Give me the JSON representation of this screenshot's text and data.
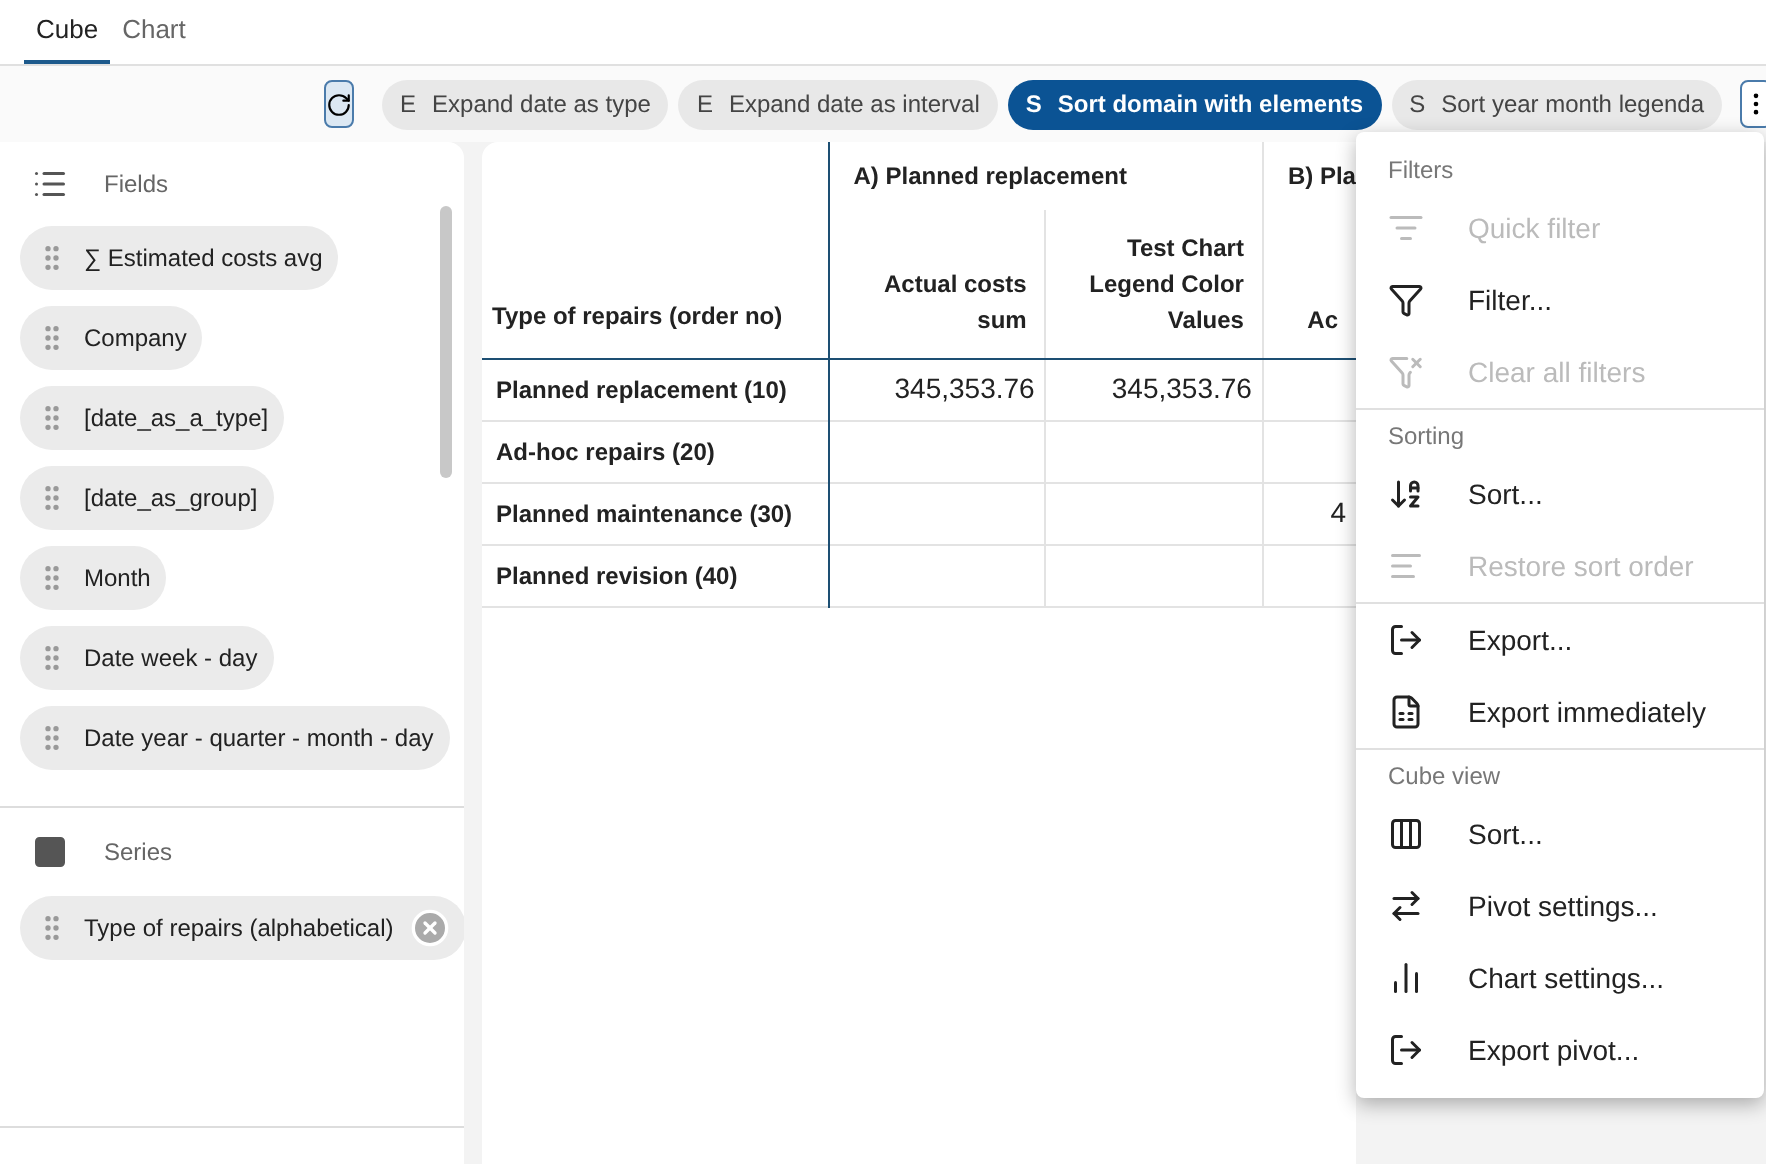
{
  "tabs": [
    {
      "label": "Cube",
      "selected": true
    },
    {
      "label": "Chart",
      "selected": false
    }
  ],
  "chips": [
    {
      "prefix": "E",
      "label": "Expand date as type",
      "selected": false
    },
    {
      "prefix": "E",
      "label": "Expand date as interval",
      "selected": false
    },
    {
      "prefix": "S",
      "label": "Sort domain with elements",
      "selected": true
    },
    {
      "prefix": "S",
      "label": "Sort year month legenda",
      "selected": false
    }
  ],
  "fields": {
    "title": "Fields",
    "items": [
      "∑ Estimated costs avg",
      "Company",
      "[date_as_a_type]",
      "[date_as_group]",
      "Month",
      "Date week - day",
      "Date year - quarter - month - day"
    ]
  },
  "series": {
    "title": "Series",
    "items": [
      "Type of repairs (alphabetical)"
    ]
  },
  "table": {
    "row_header": "Type of repairs (order no)",
    "groups": [
      {
        "label": "A) Planned replacement",
        "columns": [
          "Actual costs sum",
          "Test Chart Legend Color Values"
        ]
      },
      {
        "label": "B) Pla",
        "columns": [
          "Ac"
        ]
      }
    ],
    "rows": [
      {
        "label": "Planned replacement (10)",
        "cells": [
          "345,353.76",
          "345,353.76",
          ""
        ]
      },
      {
        "label": "Ad-hoc repairs (20)",
        "cells": [
          "",
          "",
          ""
        ]
      },
      {
        "label": "Planned maintenance (30)",
        "cells": [
          "",
          "",
          "4"
        ]
      },
      {
        "label": "Planned revision (40)",
        "cells": [
          "",
          "",
          ""
        ]
      }
    ]
  },
  "menu": {
    "sections": [
      {
        "title": "Filters",
        "items": [
          {
            "label": "Quick filter",
            "disabled": true
          },
          {
            "label": "Filter...",
            "disabled": false
          },
          {
            "label": "Clear all filters",
            "disabled": true
          }
        ]
      },
      {
        "title": "Sorting",
        "items": [
          {
            "label": "Sort...",
            "disabled": false
          },
          {
            "label": "Restore sort order",
            "disabled": true
          }
        ]
      },
      {
        "items": [
          {
            "label": "Export...",
            "disabled": false
          },
          {
            "label": "Export immediately",
            "disabled": false
          }
        ]
      },
      {
        "title": "Cube view",
        "items": [
          {
            "label": "Sort...",
            "disabled": false
          },
          {
            "label": "Pivot settings...",
            "disabled": false
          },
          {
            "label": "Chart settings...",
            "disabled": false
          },
          {
            "label": "Export pivot...",
            "disabled": false
          }
        ]
      }
    ]
  }
}
